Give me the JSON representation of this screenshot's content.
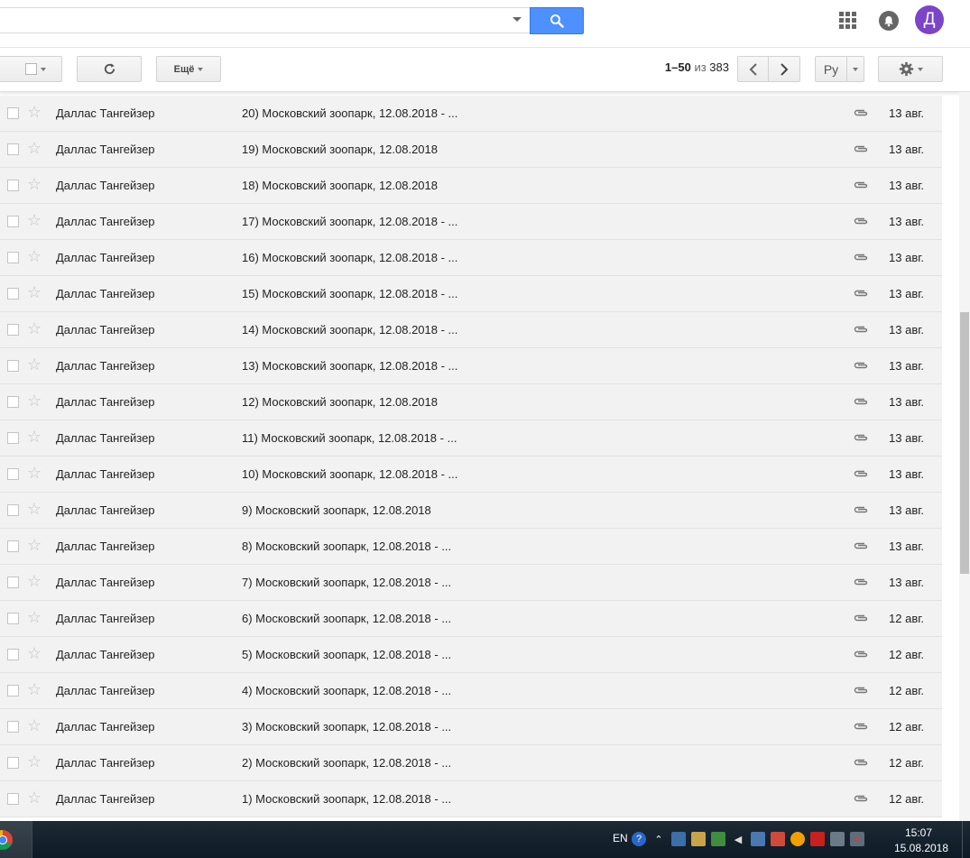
{
  "header": {
    "search_placeholder": "",
    "avatar_letter": "Д"
  },
  "toolbar": {
    "more_label": "Ещё",
    "pager_range": "1–50",
    "pager_of": "из",
    "pager_total": "383",
    "lang_label": "Ру"
  },
  "emails": [
    {
      "sender": "Даллас Тангейзер",
      "subject": "20) Московский зоопарк, 12.08.2018 - ...",
      "date": "13 авг."
    },
    {
      "sender": "Даллас Тангейзер",
      "subject": "19) Московский зоопарк, 12.08.2018",
      "date": "13 авг."
    },
    {
      "sender": "Даллас Тангейзер",
      "subject": "18) Московский зоопарк, 12.08.2018",
      "date": "13 авг."
    },
    {
      "sender": "Даллас Тангейзер",
      "subject": "17) Московский зоопарк, 12.08.2018 - ...",
      "date": "13 авг."
    },
    {
      "sender": "Даллас Тангейзер",
      "subject": "16) Московский зоопарк, 12.08.2018 - ...",
      "date": "13 авг."
    },
    {
      "sender": "Даллас Тангейзер",
      "subject": "15) Московский зоопарк, 12.08.2018 - ...",
      "date": "13 авг."
    },
    {
      "sender": "Даллас Тангейзер",
      "subject": "14) Московский зоопарк, 12.08.2018 - ...",
      "date": "13 авг."
    },
    {
      "sender": "Даллас Тангейзер",
      "subject": "13) Московский зоопарк, 12.08.2018 - ...",
      "date": "13 авг."
    },
    {
      "sender": "Даллас Тангейзер",
      "subject": "12) Московский зоопарк, 12.08.2018",
      "date": "13 авг."
    },
    {
      "sender": "Даллас Тангейзер",
      "subject": "11) Московский зоопарк, 12.08.2018 - ...",
      "date": "13 авг."
    },
    {
      "sender": "Даллас Тангейзер",
      "subject": "10) Московский зоопарк, 12.08.2018 - ...",
      "date": "13 авг."
    },
    {
      "sender": "Даллас Тангейзер",
      "subject": "9) Московский зоопарк, 12.08.2018",
      "date": "13 авг."
    },
    {
      "sender": "Даллас Тангейзер",
      "subject": "8) Московский зоопарк, 12.08.2018 - ...",
      "date": "13 авг."
    },
    {
      "sender": "Даллас Тангейзер",
      "subject": "7) Московский зоопарк, 12.08.2018 - ...",
      "date": "13 авг."
    },
    {
      "sender": "Даллас Тангейзер",
      "subject": "6) Московский зоопарк, 12.08.2018 - ...",
      "date": "12 авг."
    },
    {
      "sender": "Даллас Тангейзер",
      "subject": "5) Московский зоопарк, 12.08.2018 - ...",
      "date": "12 авг."
    },
    {
      "sender": "Даллас Тангейзер",
      "subject": "4) Московский зоопарк, 12.08.2018 - ...",
      "date": "12 авг."
    },
    {
      "sender": "Даллас Тангейзер",
      "subject": "3) Московский зоопарк, 12.08.2018 - ...",
      "date": "12 авг."
    },
    {
      "sender": "Даллас Тангейзер",
      "subject": "2) Московский зоопарк, 12.08.2018 - ...",
      "date": "12 авг."
    },
    {
      "sender": "Даллас Тангейзер",
      "subject": "1) Московский зоопарк, 12.08.2018 - ...",
      "date": "12 авг."
    }
  ],
  "taskbar": {
    "input_language": "EN",
    "time": "15:07",
    "date": "15.08.2018"
  },
  "colors": {
    "search_button": "#4d90fe",
    "avatar": "#7b45c9",
    "row_background": "#f2f2f2"
  },
  "icons": [
    "search-icon",
    "apps-grid-icon",
    "notifications-bell-icon",
    "refresh-icon",
    "chevron-left-icon",
    "chevron-right-icon",
    "gear-icon",
    "star-icon",
    "attachment-clip-icon",
    "chrome-icon"
  ]
}
